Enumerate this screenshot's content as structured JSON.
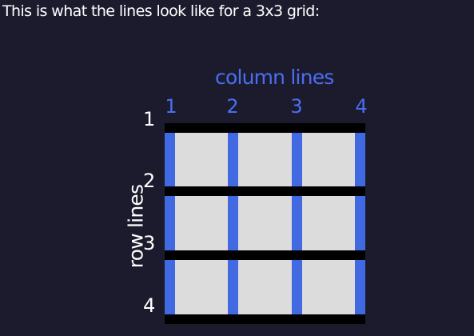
{
  "caption": "This is what the lines look like for a 3x3 grid:",
  "column_label": "column lines",
  "row_label": "row lines",
  "column_numbers": [
    "1",
    "2",
    "3",
    "4"
  ],
  "row_numbers": [
    "1",
    "2",
    "3",
    "4"
  ],
  "grid": {
    "columns": 3,
    "rows": 3
  },
  "colors": {
    "column_line": "#4169e1",
    "row_line": "#000000",
    "cell": "#dcdcdc",
    "background": "#1c1b2d"
  }
}
